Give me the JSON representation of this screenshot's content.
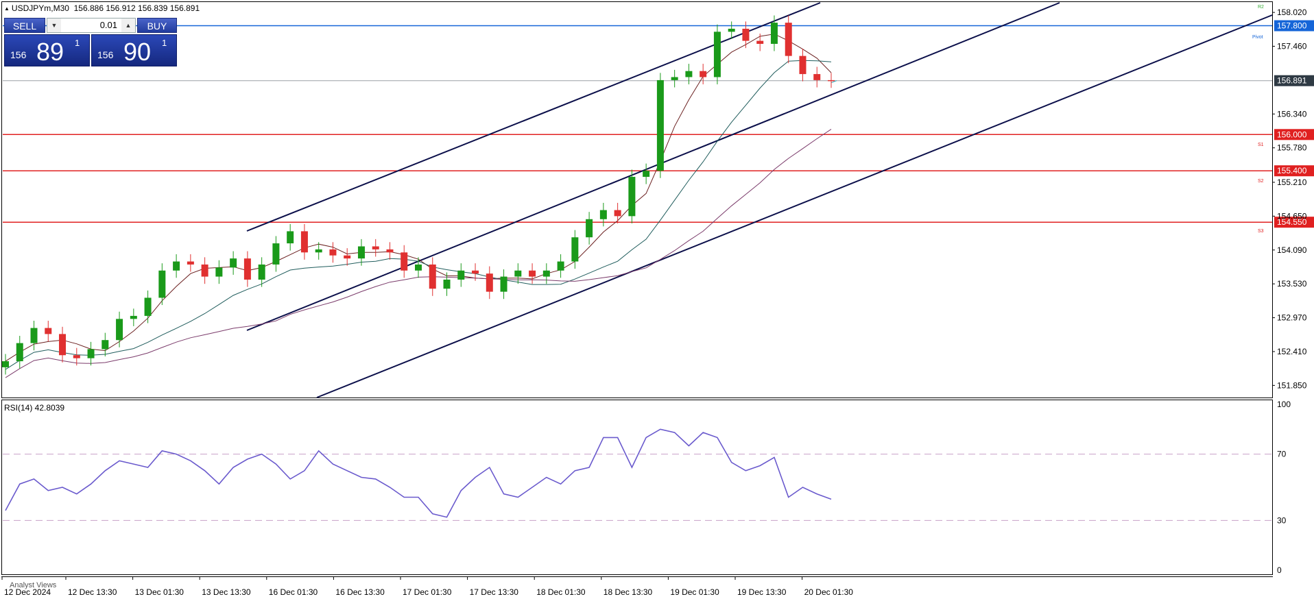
{
  "header": {
    "symbol": "USDJPYm,M30",
    "quote": "156.886 156.912 156.839 156.891"
  },
  "trade_panel": {
    "sell_label": "SELL",
    "buy_label": "BUY",
    "lot": "0.01",
    "sell_big": "156",
    "sell_main": "89",
    "sell_sup": "1",
    "buy_big": "156",
    "buy_main": "90",
    "buy_sup": "1"
  },
  "rsi_label": "RSI(14) 42.8039",
  "bottom_label": "Analyst Views",
  "pivot_labels": {
    "pivot": "Pivot",
    "r2": "R2",
    "s1": "S1",
    "s2": "S2",
    "s3": "S3"
  },
  "colors": {
    "level_red": "#e02020",
    "pivot_blue": "#1565d8",
    "channel": "#0b0f4a",
    "bull": "#1a9a1a",
    "bear": "#e03030",
    "rsi": "#6a5acd",
    "current_box": "#2f3a44"
  },
  "chart_data": {
    "type": "candlestick",
    "price_ticks": [
      "158.020",
      "157.460",
      "156.340",
      "155.780",
      "155.210",
      "154.650",
      "154.090",
      "153.530",
      "152.970",
      "152.410",
      "151.850"
    ],
    "price_tick_values": [
      158.02,
      157.46,
      156.34,
      155.78,
      155.21,
      154.65,
      154.09,
      153.53,
      152.97,
      152.41,
      151.85
    ],
    "ylim": [
      151.65,
      158.18
    ],
    "x_ticks": [
      "12 Dec 2024",
      "12 Dec 13:30",
      "13 Dec 01:30",
      "13 Dec 13:30",
      "16 Dec 01:30",
      "16 Dec 13:30",
      "17 Dec 01:30",
      "17 Dec 13:30",
      "18 Dec 01:30",
      "18 Dec 13:30",
      "19 Dec 01:30",
      "19 Dec 13:30",
      "20 Dec 01:30"
    ],
    "levels": [
      {
        "label": "157.800",
        "value": 157.8,
        "kind": "pivot"
      },
      {
        "label": "156.000",
        "value": 156.0,
        "kind": "support"
      },
      {
        "label": "155.400",
        "value": 155.4,
        "kind": "support"
      },
      {
        "label": "154.550",
        "value": 154.55,
        "kind": "support"
      }
    ],
    "current_price": {
      "label": "156.891",
      "value": 156.891
    },
    "close_series": [
      152.25,
      152.55,
      152.8,
      152.7,
      152.35,
      152.3,
      152.45,
      152.6,
      152.95,
      153.0,
      153.3,
      153.75,
      153.9,
      153.85,
      153.65,
      153.8,
      153.95,
      153.6,
      153.85,
      154.2,
      154.4,
      154.05,
      154.1,
      154.0,
      153.95,
      154.15,
      154.1,
      154.05,
      153.75,
      153.85,
      153.45,
      153.6,
      153.75,
      153.7,
      153.4,
      153.65,
      153.75,
      153.65,
      153.75,
      153.9,
      154.3,
      154.6,
      154.75,
      154.65,
      155.3,
      155.4,
      156.9,
      156.95,
      157.05,
      156.95,
      157.7,
      157.75,
      157.55,
      157.5,
      157.85,
      157.3,
      157.0,
      156.9,
      156.891
    ],
    "channel_lines": [
      {
        "name": "upper",
        "points": [
          [
            0.0,
            155.0
          ],
          [
            1.0,
            158.5
          ]
        ]
      }
    ],
    "rsi": {
      "ticks": [
        "100",
        "70",
        "30",
        "0"
      ],
      "tick_values": [
        100,
        70,
        30,
        0
      ],
      "levels": [
        70,
        30
      ],
      "values": [
        36,
        52,
        55,
        48,
        50,
        46,
        52,
        60,
        66,
        64,
        62,
        72,
        70,
        66,
        60,
        52,
        62,
        67,
        70,
        64,
        55,
        60,
        72,
        64,
        60,
        56,
        55,
        50,
        44,
        44,
        34,
        32,
        48,
        56,
        62,
        46,
        44,
        50,
        56,
        52,
        60,
        62,
        80,
        80,
        62,
        80,
        85,
        83,
        75,
        83,
        80,
        65,
        60,
        63,
        68,
        44,
        50,
        46,
        42.8
      ]
    }
  }
}
